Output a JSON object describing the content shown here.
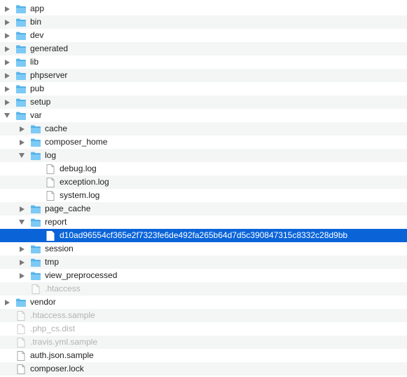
{
  "colors": {
    "selection": "#0a64d8",
    "folder": "#5bb8f0",
    "stripe": "#f4f5f5",
    "dim_text": "#b2b2b2"
  },
  "rows": [
    {
      "name": "app",
      "depth": 0,
      "kind": "folder",
      "state": "collapsed"
    },
    {
      "name": "bin",
      "depth": 0,
      "kind": "folder",
      "state": "collapsed"
    },
    {
      "name": "dev",
      "depth": 0,
      "kind": "folder",
      "state": "collapsed"
    },
    {
      "name": "generated",
      "depth": 0,
      "kind": "folder",
      "state": "collapsed"
    },
    {
      "name": "lib",
      "depth": 0,
      "kind": "folder",
      "state": "collapsed"
    },
    {
      "name": "phpserver",
      "depth": 0,
      "kind": "folder",
      "state": "collapsed"
    },
    {
      "name": "pub",
      "depth": 0,
      "kind": "folder",
      "state": "collapsed"
    },
    {
      "name": "setup",
      "depth": 0,
      "kind": "folder",
      "state": "collapsed"
    },
    {
      "name": "var",
      "depth": 0,
      "kind": "folder",
      "state": "expanded"
    },
    {
      "name": "cache",
      "depth": 1,
      "kind": "folder",
      "state": "collapsed"
    },
    {
      "name": "composer_home",
      "depth": 1,
      "kind": "folder",
      "state": "collapsed"
    },
    {
      "name": "log",
      "depth": 1,
      "kind": "folder",
      "state": "expanded"
    },
    {
      "name": "debug.log",
      "depth": 2,
      "kind": "file"
    },
    {
      "name": "exception.log",
      "depth": 2,
      "kind": "file"
    },
    {
      "name": "system.log",
      "depth": 2,
      "kind": "file"
    },
    {
      "name": "page_cache",
      "depth": 1,
      "kind": "folder",
      "state": "collapsed"
    },
    {
      "name": "report",
      "depth": 1,
      "kind": "folder",
      "state": "expanded"
    },
    {
      "name": "d10ad96554cf365e2f7323fe6de492fa265b64d7d5c390847315c8332c28d9bb",
      "depth": 2,
      "kind": "file",
      "selected": true
    },
    {
      "name": "session",
      "depth": 1,
      "kind": "folder",
      "state": "collapsed"
    },
    {
      "name": "tmp",
      "depth": 1,
      "kind": "folder",
      "state": "collapsed"
    },
    {
      "name": "view_preprocessed",
      "depth": 1,
      "kind": "folder",
      "state": "collapsed"
    },
    {
      "name": ".htaccess",
      "depth": 1,
      "kind": "file",
      "hidden": true
    },
    {
      "name": "vendor",
      "depth": 0,
      "kind": "folder",
      "state": "collapsed"
    },
    {
      "name": ".htaccess.sample",
      "depth": 0,
      "kind": "file",
      "hidden": true
    },
    {
      "name": ".php_cs.dist",
      "depth": 0,
      "kind": "file",
      "hidden": true
    },
    {
      "name": ".travis.yml.sample",
      "depth": 0,
      "kind": "file",
      "hidden": true
    },
    {
      "name": "auth.json.sample",
      "depth": 0,
      "kind": "file"
    },
    {
      "name": "composer.lock",
      "depth": 0,
      "kind": "file"
    }
  ]
}
